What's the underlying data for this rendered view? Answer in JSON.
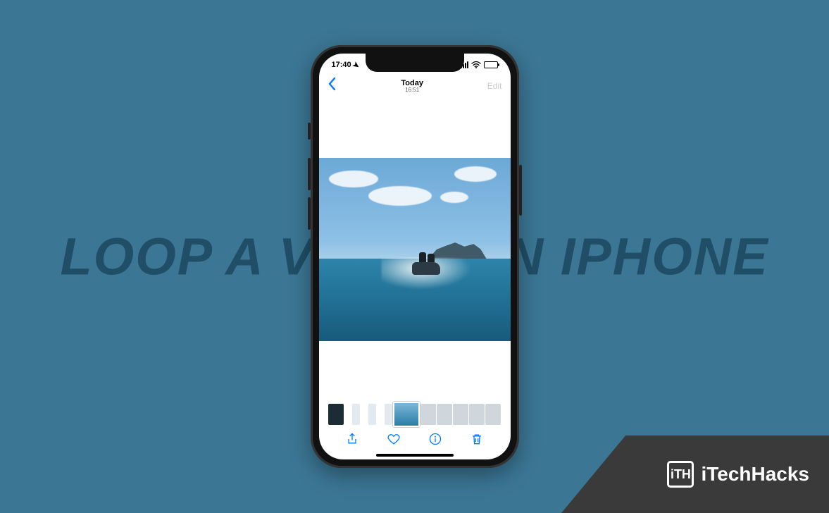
{
  "background_text": "LOOP A VIDEO ON IPHONE",
  "brand": {
    "logo_text": "iTH",
    "name": "iTechHacks"
  },
  "status": {
    "time": "17:40",
    "location_arrow": "➤"
  },
  "nav": {
    "back_icon": "chevron-left",
    "title": "Today",
    "subtitle": "16:51",
    "edit_label": "Edit"
  },
  "photo": {
    "subject": "jetski-on-tropical-sea"
  },
  "toolbar": {
    "share": "share-icon",
    "favorite": "heart-icon",
    "info": "info-icon",
    "delete": "trash-icon"
  },
  "colors": {
    "background": "#3b7694",
    "ios_tint": "#007aff",
    "brand_bg": "#3a3a3a"
  }
}
